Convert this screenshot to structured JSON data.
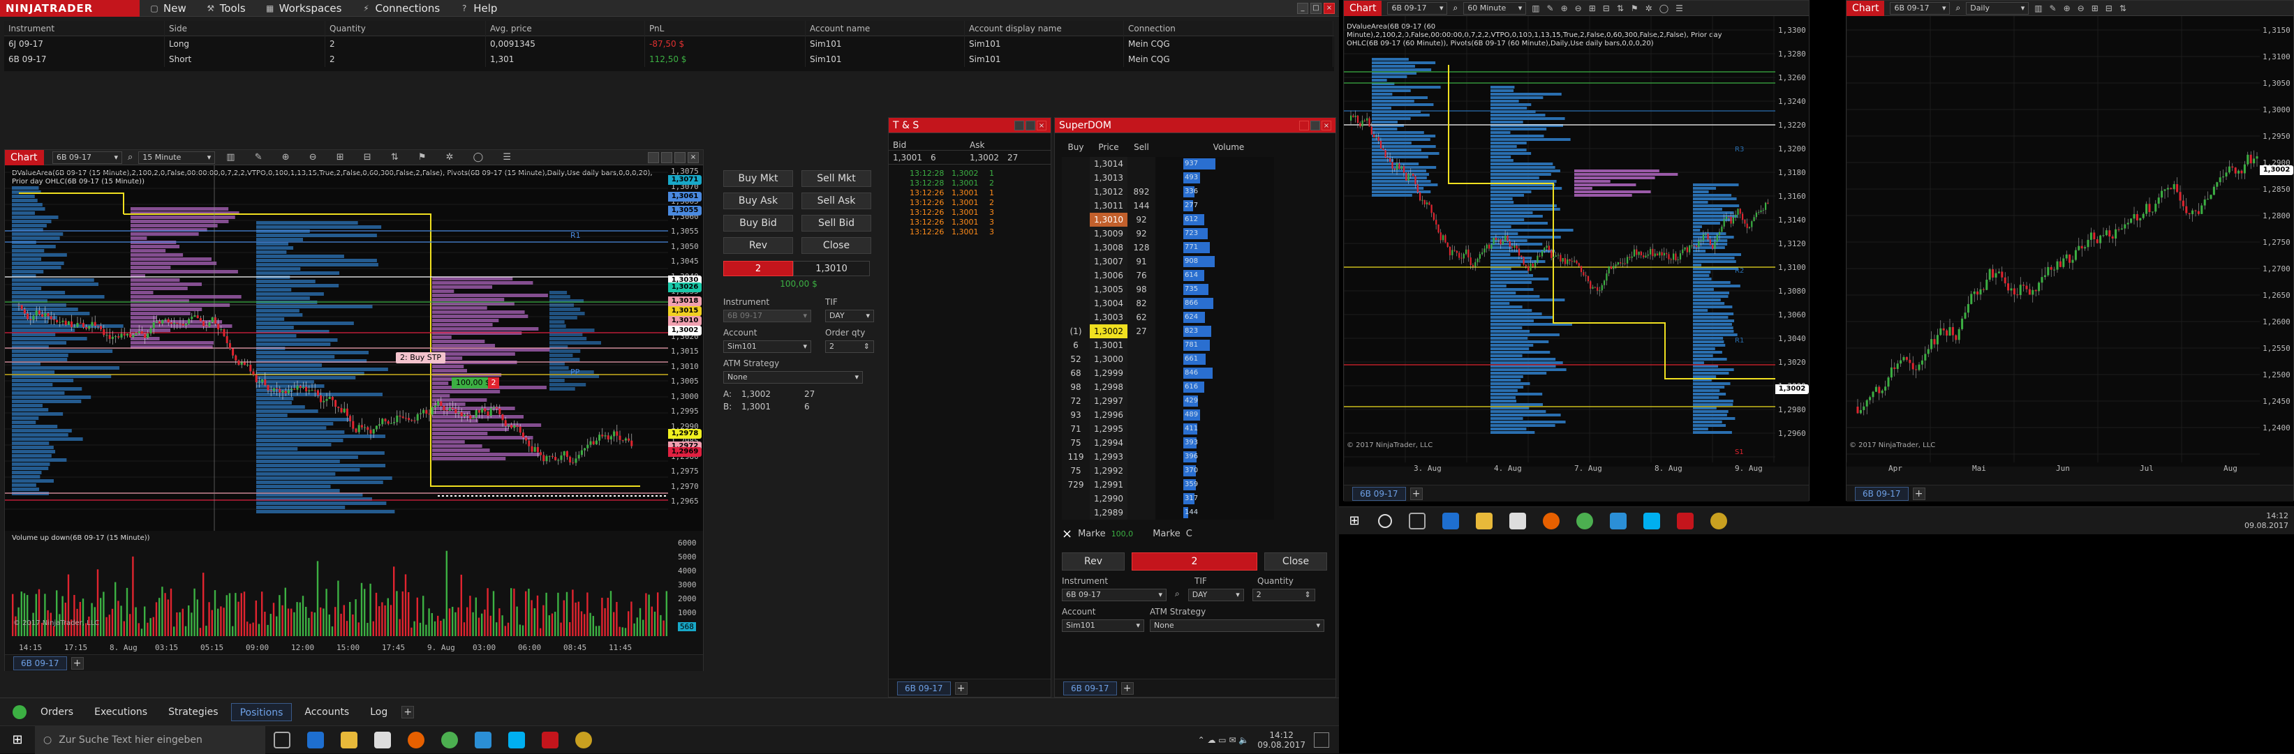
{
  "app": {
    "logo": "NINJATRADER",
    "menu": [
      {
        "label": "New",
        "icon": "file-icon"
      },
      {
        "label": "Tools",
        "icon": "wrench-icon"
      },
      {
        "label": "Workspaces",
        "icon": "layout-icon"
      },
      {
        "label": "Connections",
        "icon": "plug-icon"
      },
      {
        "label": "Help",
        "icon": "help-icon"
      }
    ]
  },
  "positions": {
    "headers": [
      "Instrument",
      "Side",
      "Quantity",
      "Avg. price",
      "PnL",
      "Account name",
      "Account display name",
      "Connection"
    ],
    "rows": [
      [
        "6J 09-17",
        "Long",
        "2",
        "0,0091345",
        "-87,50 $",
        "Sim101",
        "Sim101",
        "Mein CQG"
      ],
      [
        "6B 09-17",
        "Short",
        "2",
        "1,301",
        "112,50 $",
        "Sim101",
        "Sim101",
        "Mein CQG"
      ]
    ]
  },
  "chart1": {
    "title": "Chart",
    "instrument": "6B 09-17",
    "interval": "15 Minute",
    "info": "DValueArea(6B 09-17 (15 Minute),2,100,2,0,False,00:00:00,0,7,2,2,VTPO,0,100,1,13,15,True,2,False,0,60,300,False,2,False), Pivots(6B 09-17 (15 Minute),Daily,Use daily bars,0,0,0,20), Prior day OHLC(6B 09-17 (15 Minute))",
    "price_ticks": [
      "1,3075",
      "1,3070",
      "1,3065",
      "1,3060",
      "1,3055",
      "1,3050",
      "1,3045",
      "1,3040",
      "1,3035",
      "1,3030",
      "1,3025",
      "1,3020",
      "1,3015",
      "1,3010",
      "1,3005",
      "1,3000",
      "1,2995",
      "1,2990",
      "1,2985",
      "1,2980",
      "1,2975",
      "1,2970",
      "1,2965"
    ],
    "price_boxes": [
      {
        "value": "1,3071",
        "color": "#18a8c8"
      },
      {
        "value": "1,3061",
        "color": "#4a8ae0"
      },
      {
        "value": "1,3055",
        "color": "#4a8ae0"
      },
      {
        "value": "1,3030",
        "color": "#ffffff"
      },
      {
        "value": "1,3026",
        "color": "#18c8a8"
      },
      {
        "value": "1,3018",
        "color": "#f0a0b0"
      },
      {
        "value": "1,3015",
        "color": "#f0d020"
      },
      {
        "value": "1,3010",
        "color": "#f0a0b0"
      },
      {
        "value": "1,3002",
        "color": "#ffffff"
      },
      {
        "value": "1,2978",
        "color": "#f0f020"
      },
      {
        "value": "1,2972",
        "color": "#f0a0b0"
      },
      {
        "value": "1,2969",
        "color": "#e02040"
      }
    ],
    "time_ticks": [
      "14:15",
      "17:15",
      "8. Aug",
      "03:15",
      "05:15",
      "09:00",
      "12:00",
      "15:00",
      "17:45",
      "9. Aug",
      "03:00",
      "06:00",
      "08:45",
      "11:45"
    ],
    "pivot_labels": {
      "r1": "R1",
      "pp": "PP"
    },
    "order_label": "2: Buy STP",
    "pnl_flag": "100,00 $",
    "pnl_qty": "2",
    "indicator": "Volume up down(6B 09-17 (15 Minute))",
    "vol_ticks": [
      "6000",
      "5000",
      "4000",
      "3000",
      "2000",
      "1000",
      "568"
    ],
    "copyright": "© 2017 NinjaTrader, LLC",
    "tab": "6B 09-17"
  },
  "chart_trader": {
    "buttons": [
      "Buy Mkt",
      "Sell Mkt",
      "Buy Ask",
      "Sell Ask",
      "Buy Bid",
      "Sell Bid",
      "Rev",
      "Close"
    ],
    "position_qty": "2",
    "position_price": "1,3010",
    "pnl": "100,00 $",
    "instrument_label": "Instrument",
    "instrument": "6B 09-17",
    "tif_label": "TIF",
    "tif": "DAY",
    "account_label": "Account",
    "account": "Sim101",
    "qty_label": "Order qty",
    "qty": "2",
    "atm_label": "ATM Strategy",
    "atm": "None",
    "ask_line": [
      "A:",
      "1,3002",
      "27"
    ],
    "bid_line": [
      "B:",
      "1,3001",
      "6"
    ]
  },
  "ts": {
    "title": "T & S",
    "headers": [
      "Bid",
      "Ask"
    ],
    "bid": "1,3001",
    "bid_size": "6",
    "ask": "1,3002",
    "ask_size": "27",
    "trades": [
      [
        "13:12:28",
        "1,3002",
        "1",
        "#3cb043"
      ],
      [
        "13:12:28",
        "1,3001",
        "2",
        "#3cb043"
      ],
      [
        "13:12:26",
        "1,3001",
        "1",
        "#ff8c1a"
      ],
      [
        "13:12:26",
        "1,3001",
        "2",
        "#ff8c1a"
      ],
      [
        "13:12:26",
        "1,3001",
        "3",
        "#ff8c1a"
      ],
      [
        "13:12:26",
        "1,3001",
        "3",
        "#ff8c1a"
      ],
      [
        "13:12:26",
        "1,3001",
        "3",
        "#ff8c1a"
      ]
    ],
    "tab": "6B 09-17"
  },
  "dom": {
    "title": "SuperDOM",
    "headers": [
      "Buy",
      "Price",
      "Sell",
      "Volume"
    ],
    "rows": [
      [
        "",
        "1,3014",
        "",
        "937"
      ],
      [
        "",
        "1,3013",
        "",
        "493"
      ],
      [
        "",
        "1,3012",
        "892",
        "336"
      ],
      [
        "",
        "1,3011",
        "144",
        "277"
      ],
      [
        "",
        "1,3010",
        "92",
        "612"
      ],
      [
        "",
        "1,3009",
        "92",
        "723"
      ],
      [
        "",
        "1,3008",
        "128",
        "771"
      ],
      [
        "",
        "1,3007",
        "91",
        "908"
      ],
      [
        "",
        "1,3006",
        "76",
        "614"
      ],
      [
        "",
        "1,3005",
        "98",
        "735"
      ],
      [
        "",
        "1,3004",
        "82",
        "866"
      ],
      [
        "",
        "1,3003",
        "62",
        "624"
      ],
      [
        "(1)",
        "1,3002",
        "27",
        "823"
      ],
      [
        "6",
        "1,3001",
        "",
        "781"
      ],
      [
        "52",
        "1,3000",
        "",
        "661"
      ],
      [
        "68",
        "1,2999",
        "",
        "846"
      ],
      [
        "98",
        "1,2998",
        "",
        "616"
      ],
      [
        "72",
        "1,2997",
        "",
        "429"
      ],
      [
        "93",
        "1,2996",
        "",
        "489"
      ],
      [
        "71",
        "1,2995",
        "",
        "411"
      ],
      [
        "75",
        "1,2994",
        "",
        "393"
      ],
      [
        "119",
        "1,2993",
        "",
        "396"
      ],
      [
        "75",
        "1,2992",
        "",
        "370"
      ],
      [
        "729",
        "1,2991",
        "",
        "359"
      ],
      [
        "",
        "1,2990",
        "",
        "317"
      ],
      [
        "",
        "1,2989",
        "",
        "144"
      ]
    ],
    "market_left_label": "Marke",
    "market_left_val": "100,0",
    "market_right_label": "Marke",
    "market_right_val": "C",
    "rev": "Rev",
    "qty": "2",
    "close": "Close",
    "instrument_label": "Instrument",
    "instrument": "6B 09-17",
    "tif_label": "TIF",
    "tif": "DAY",
    "quantity_label": "Quantity",
    "quantity": "2",
    "account_label": "Account",
    "account": "Sim101",
    "atm_label": "ATM Strategy",
    "atm": "None",
    "tab": "6B 09-17"
  },
  "bottom_tabs": [
    "Orders",
    "Executions",
    "Strategies",
    "Positions",
    "Accounts",
    "Log"
  ],
  "bottom_active": "Positions",
  "taskbar_left": {
    "search": "Zur Suche Text hier eingeben",
    "time": "14:12",
    "date": "09.08.2017"
  },
  "chart2": {
    "title": "Chart",
    "instrument": "6B 09-17",
    "interval": "60 Minute",
    "info": "DValueArea(6B 09-17 (60 Minute),2,100,2,0,False,00:00:00,0,7,2,2,VTPO,0,100,1,13,15,True,2,False,0,60,300,False,2,False), Prior day OHLC(6B 09-17 (60 Minute)), Pivots(6B 09-17 (60 Minute),Daily,Use daily bars,0,0,0,20)",
    "price_ticks": [
      "1,3300",
      "1,3280",
      "1,3260",
      "1,3240",
      "1,3220",
      "1,3200",
      "1,3180",
      "1,3160",
      "1,3140",
      "1,3120",
      "1,3100",
      "1,3080",
      "1,3060",
      "1,3040",
      "1,3020",
      "1,3000",
      "1,2980",
      "1,2960"
    ],
    "time_ticks": [
      "3. Aug",
      "4. Aug",
      "7. Aug",
      "8. Aug",
      "9. Aug"
    ],
    "last_price": "1,3002",
    "copyright": "© 2017 NinjaTrader, LLC",
    "tab": "6B 09-17",
    "pivot_labels": [
      "R3",
      "R2",
      "R1",
      "S1"
    ]
  },
  "chart3": {
    "title": "Chart",
    "instrument": "6B 09-17",
    "interval": "Daily",
    "price_ticks": [
      "1,3150",
      "1,3100",
      "1,3050",
      "1,3000",
      "1,2950",
      "1,2900",
      "1,2850",
      "1,2800",
      "1,2750",
      "1,2700",
      "1,2650",
      "1,2600",
      "1,2550",
      "1,2500",
      "1,2450",
      "1,2400"
    ],
    "time_ticks": [
      "Apr",
      "Mai",
      "Jun",
      "Jul",
      "Aug"
    ],
    "last_price": "1,3002",
    "copyright": "© 2017 NinjaTrader, LLC",
    "tab": "6B 09-17"
  },
  "taskbar_right": {
    "time": "14:12",
    "date": "09.08.2017"
  }
}
